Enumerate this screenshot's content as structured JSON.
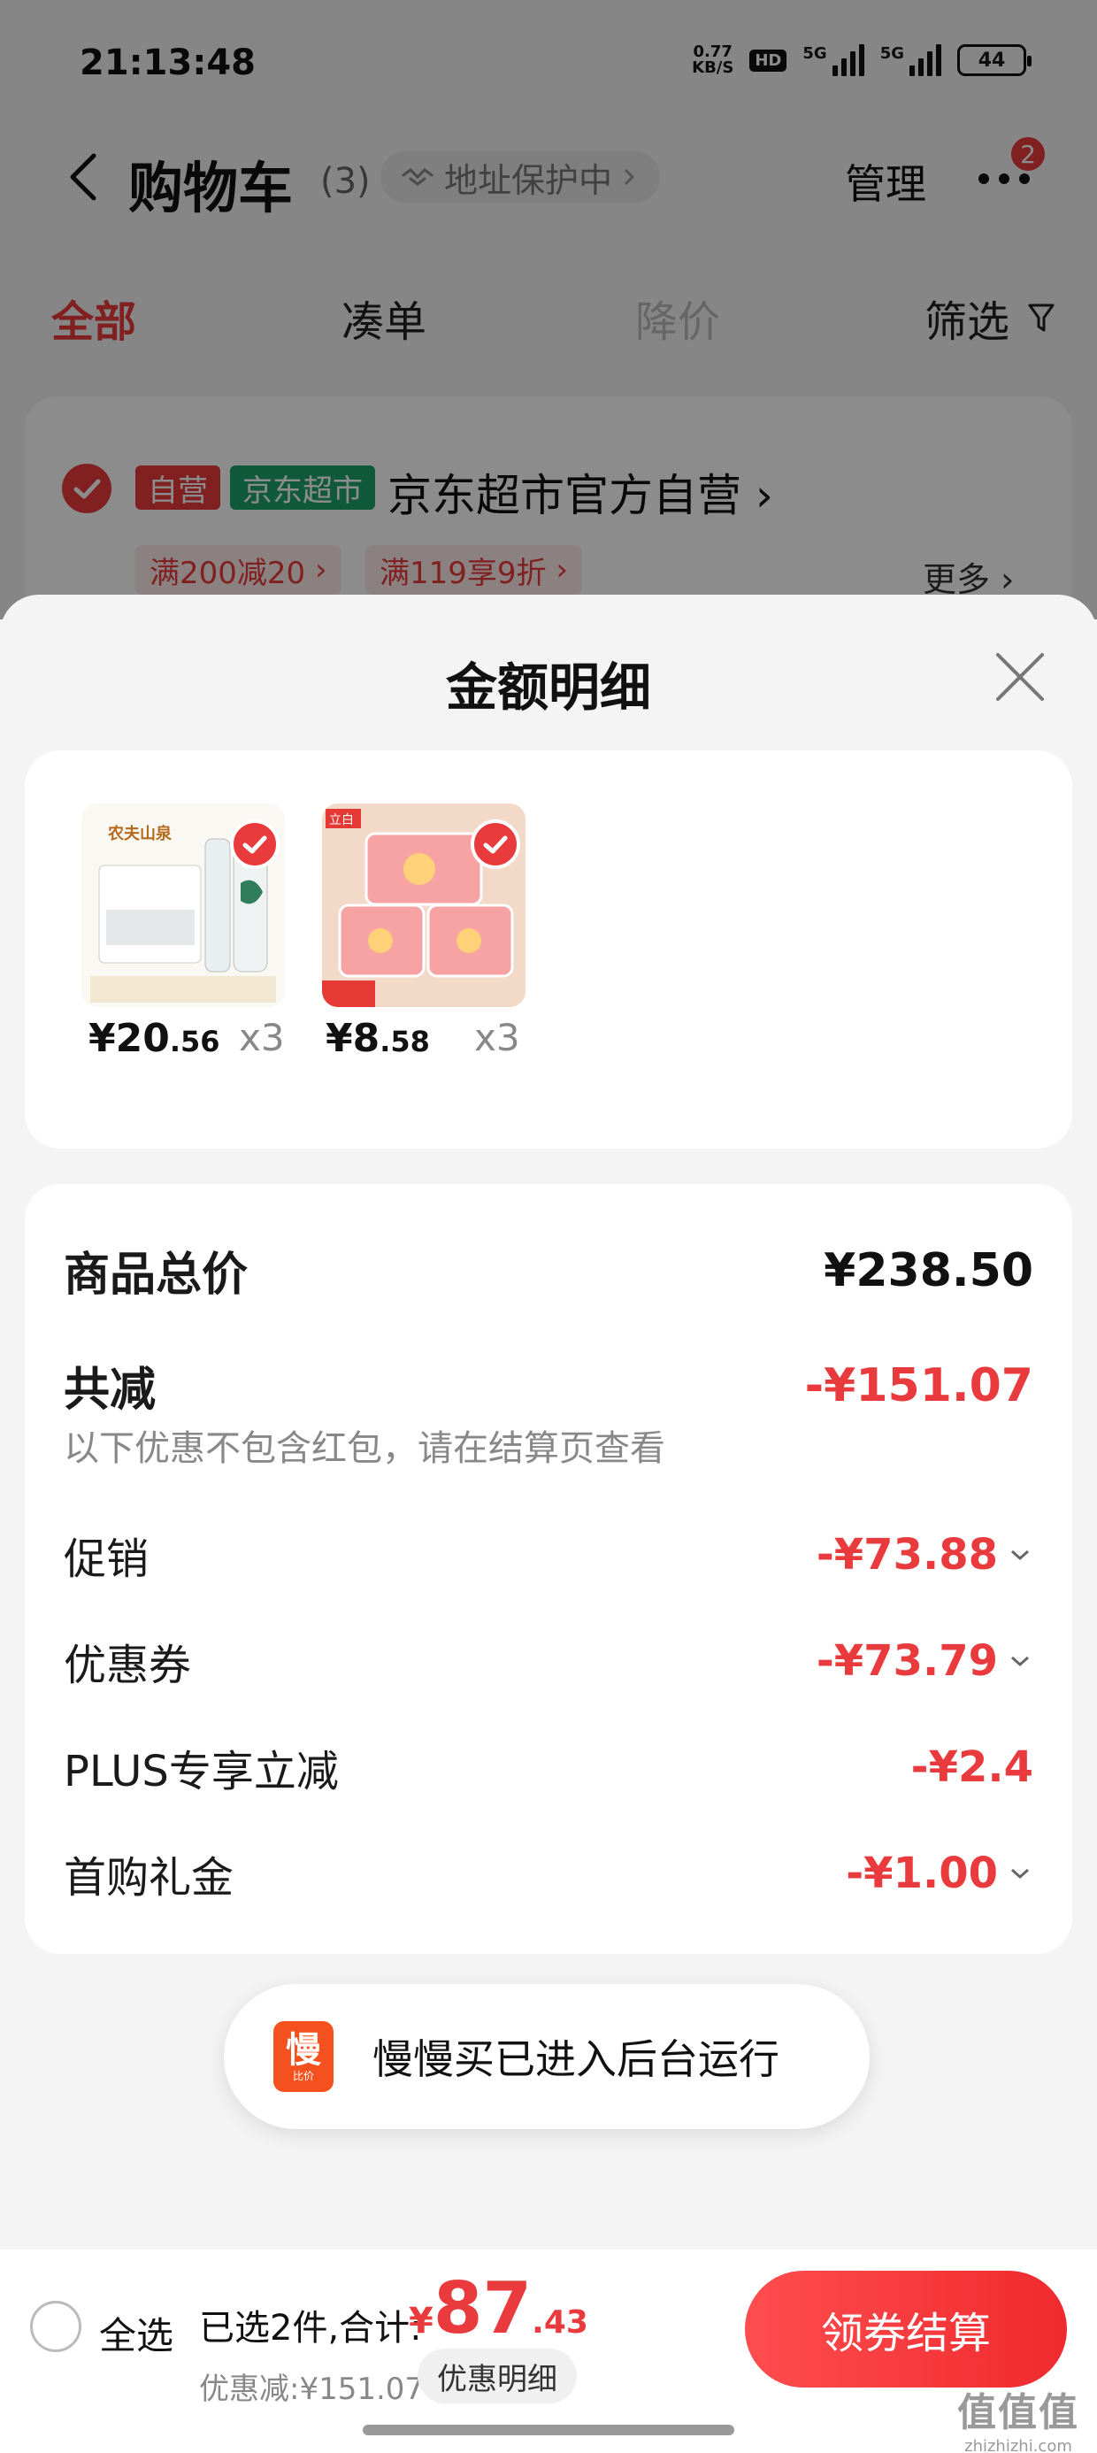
{
  "status_bar": {
    "time": "21:13:48",
    "net_speed_value": "0.77",
    "net_speed_unit": "KB/S",
    "hd_label": "HD",
    "signal_1": "5G",
    "signal_2": "5G",
    "battery": "44"
  },
  "nav": {
    "title": "购物车",
    "count": "(3)",
    "address_protect": "地址保护中",
    "manage": "管理",
    "badge": "2"
  },
  "tabs": {
    "all": "全部",
    "bundle": "凑单",
    "price_drop": "降价",
    "filter": "筛选"
  },
  "store": {
    "tag_self": "自营",
    "tag_market": "京东超市",
    "name": "京东超市官方自营",
    "promo_1": "满200减20",
    "promo_2": "满119享9折",
    "more": "更多"
  },
  "sheet": {
    "title": "金额明细"
  },
  "products": [
    {
      "price_int": "¥20",
      "price_dec": ".56",
      "qty": "x3",
      "brand": "农夫山泉"
    },
    {
      "price_int": "¥8",
      "price_dec": ".58",
      "qty": "x3",
      "brand": "立白"
    }
  ],
  "summary": {
    "total_label": "商品总价",
    "total_value": "¥238.50",
    "reduce_label": "共减",
    "reduce_value": "-¥151.07",
    "reduce_note": "以下优惠不包含红包，请在结算页查看",
    "rows": [
      {
        "label": "促销",
        "value": "-¥73.88"
      },
      {
        "label": "优惠券",
        "value": "-¥73.79"
      },
      {
        "label": "PLUS专享立减",
        "value": "-¥2.4"
      },
      {
        "label": "首购礼金",
        "value": "-¥1.00"
      }
    ]
  },
  "toast": {
    "icon_char": "慢",
    "icon_sub": "比价",
    "text": "慢慢买已进入后台运行"
  },
  "bottom": {
    "select_all": "全选",
    "selected_count": "已选2件,合计:",
    "currency": "¥",
    "total_int": "87",
    "total_dec": ".43",
    "discount": "优惠减:¥151.07",
    "detail_button": "优惠明细",
    "checkout_button": "领券结算"
  },
  "watermark": {
    "big": "值值值",
    "small": "zhizhizhi.com"
  },
  "colors": {
    "accent": "#e93b3d",
    "tag_self": "#e93b3d",
    "tag_market": "#1ea26b"
  }
}
